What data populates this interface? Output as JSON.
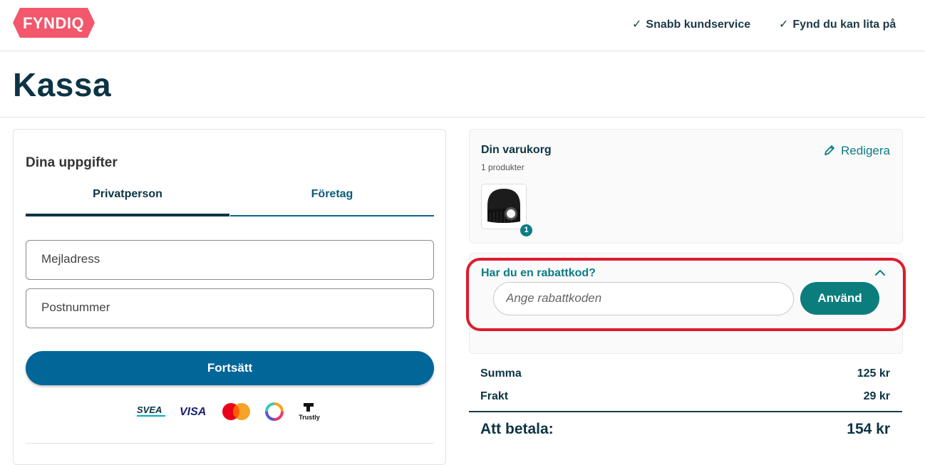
{
  "header": {
    "logo_text": "FYNDIQ",
    "usps": [
      {
        "check": "✓",
        "text": "Snabb kundservice"
      },
      {
        "check": "✓",
        "text": "Fynd du kan lita på"
      }
    ]
  },
  "page": {
    "title": "Kassa"
  },
  "details": {
    "title": "Dina uppgifter",
    "tabs": [
      {
        "label": "Privatperson",
        "selected": true
      },
      {
        "label": "Företag",
        "selected": false
      }
    ],
    "email": {
      "placeholder": "Mejladress",
      "value": ""
    },
    "zip": {
      "placeholder": "Postnummer",
      "value": ""
    },
    "continue_label": "Fortsätt",
    "payment_logos": [
      "SVEA",
      "VISA",
      "mastercard-logo",
      "swish-logo",
      "Trustly"
    ]
  },
  "cart": {
    "title": "Din varukorg",
    "count": "1 produkter",
    "edit_label": "Redigera",
    "items": [
      {
        "image": "black-led-beanie",
        "qty": "1"
      }
    ]
  },
  "discount": {
    "title": "Har du en rabattkod?",
    "placeholder": "Ange rabattkoden",
    "value": "",
    "apply_label": "Använd",
    "expanded": true
  },
  "totals": {
    "sum_label": "Summa",
    "sum_value": "125 kr",
    "shipping_label": "Frakt",
    "shipping_value": "29 kr",
    "total_label": "Att betala:",
    "total_value": "154 kr"
  },
  "colors": {
    "brand_pink": "#f2576b",
    "primary_blue": "#036698",
    "teal": "#0b7d7d",
    "highlight_red": "#dd1b2e",
    "text_dark": "#0c3444"
  }
}
